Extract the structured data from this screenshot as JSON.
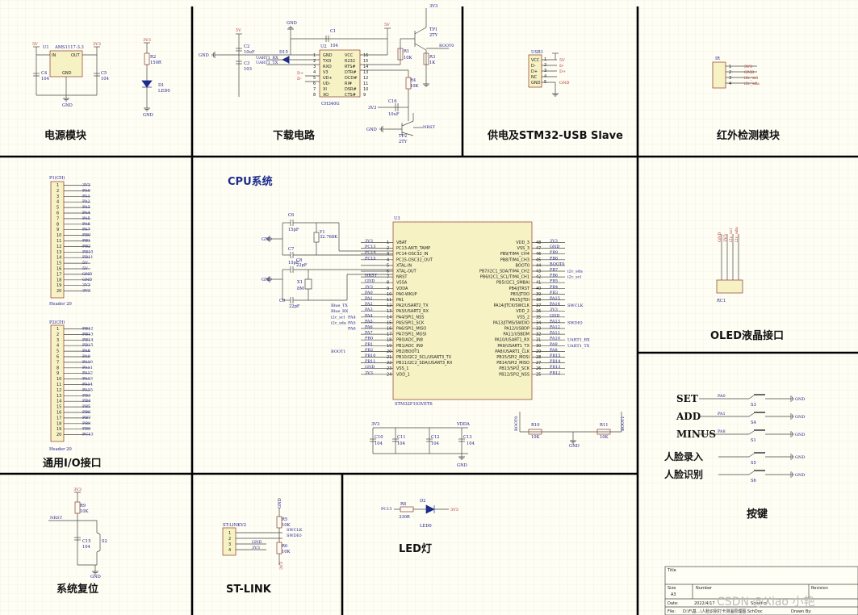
{
  "modules": {
    "power": "电源模块",
    "download": "下载电路",
    "usb": "供电及STM32-USB Slave",
    "ir": "红外检测模块",
    "cpu": "CPU系统",
    "oled": "OLED液晶接口",
    "io": "通用I/O接口",
    "keys": "按键",
    "reset": "系统复位",
    "stlink": "ST-LINK",
    "led": "LED灯"
  },
  "power": {
    "u1": "U1",
    "u1_part": "AMS1117-3.3",
    "in": "IN",
    "out": "OUT",
    "gnd_pin": "GND",
    "v5": "5V",
    "v33": "3V3",
    "c4": "C4",
    "c4v": "104",
    "c5": "C5",
    "c5v": "104",
    "gnd": "GND",
    "r2": "R2",
    "r2v": "150R",
    "d1": "D1",
    "d1v": "LED0"
  },
  "download": {
    "u2": "U2",
    "u2_part": "CH340G",
    "c1": "C1",
    "c1v": "104",
    "c2": "C2",
    "c2v": "10uF",
    "c3": "C3",
    "c3v": "103",
    "d15": "D15",
    "uart_rx": "UART1_RX",
    "uart_tx": "UART1_TX",
    "left_pins": [
      "GND",
      "TXD",
      "RXD",
      "V3",
      "UD+",
      "UD-",
      "XI",
      "XO"
    ],
    "left_nums": [
      "1",
      "2",
      "3",
      "4",
      "5",
      "6",
      "7",
      "8"
    ],
    "right_pins": [
      "VCC",
      "R232",
      "RTS#",
      "DTR#",
      "DCD#",
      "RI#",
      "DSR#",
      "CTS#"
    ],
    "right_nums": [
      "16",
      "15",
      "14",
      "13",
      "12",
      "11",
      "10",
      "9"
    ],
    "dp": "D+",
    "dm": "D-",
    "tp1": "TP1",
    "tp1v": "2TY",
    "tp2": "TP2",
    "tp2v": "2TY",
    "r1": "R1",
    "r1v": "10K",
    "r3": "R3",
    "r3v": "1K",
    "r4": "R4",
    "r4v": "10K",
    "c16": "C16",
    "c16v": "10uF",
    "boot0": "BOOT0",
    "nrst": "NRST",
    "v5": "5V",
    "v33": "3V3",
    "gnd": "GND"
  },
  "usb": {
    "ref": "USB1",
    "pins": [
      "VCC",
      "D-",
      "D+",
      "NC",
      "GND"
    ],
    "nums": [
      "1",
      "2",
      "3",
      "4",
      "5"
    ],
    "nets": [
      "5V",
      "D-",
      "D+",
      "",
      "GND"
    ]
  },
  "ir": {
    "ref": "IR",
    "nums": [
      "1",
      "2",
      "3",
      "4"
    ],
    "nets": [
      "3V3",
      "GND",
      "i2c_scl",
      "i2c_sda"
    ]
  },
  "cpu": {
    "u3": "U3",
    "part": "STM32F103VET6",
    "c6": "C6",
    "c6v": "15pF",
    "c7": "C7",
    "c7v": "15pF",
    "y1": "Y1",
    "y1v": "32.768K",
    "c8": "C8",
    "c8v": "22pF",
    "c9": "C9",
    "c9v": "22pF",
    "x1": "X1",
    "x1v": "8M",
    "left_pins": [
      "VBAT",
      "PC13-ANTI_TAMP",
      "PC14-OSC32_IN",
      "PC15-OSC32_OUT",
      "XTAL-IN",
      "XTAL-OUT",
      "NRST",
      "VSSA",
      "VDDA",
      "PA0-WKUP",
      "PA1",
      "PA2/USART2_TX",
      "PA3/USART2_RX",
      "PA4/SPI1_NSS",
      "PA5/SPI1_SCK",
      "PA6/SPI1_MISO",
      "PA7/SPI1_MOSI",
      "PB0/ADC_IN8",
      "PB1/ADC_IN9",
      "PB2/BOOT1",
      "PB10/I2C2_SCL/USART3_TX",
      "PB11/I2C2_SDA/USART3_RX",
      "VSS_1",
      "VDD_1"
    ],
    "left_nums": [
      "1",
      "2",
      "3",
      "4",
      "5",
      "6",
      "7",
      "8",
      "9",
      "10",
      "11",
      "12",
      "13",
      "14",
      "15",
      "16",
      "17",
      "18",
      "19",
      "20",
      "21",
      "22",
      "23",
      "24"
    ],
    "left_nets": [
      "3V3",
      "PC13",
      "PC14",
      "PC15",
      "",
      "",
      "NRST",
      "GND",
      "3V3",
      "PA0",
      "PA1",
      "PA2",
      "PA3",
      "PA4",
      "PA5",
      "PA6",
      "PA7",
      "PB0",
      "PB1",
      "PB2",
      "PB10",
      "PB11",
      "GND",
      "3V3"
    ],
    "left_ext": [
      "",
      "",
      "",
      "",
      "",
      "",
      "",
      "",
      "",
      "",
      "",
      "Blue_TX",
      "Blue_RX",
      "i2c_scl",
      "i2c_sda",
      "",
      "",
      "",
      "",
      "BOOT1",
      "",
      "",
      "",
      ""
    ],
    "left_ext_extra": [
      "",
      "",
      "",
      "",
      "",
      "",
      "",
      "",
      "",
      "",
      "",
      "",
      "",
      "PA4",
      "PA5",
      "PA6",
      "",
      "",
      "",
      "",
      "",
      "",
      "",
      ""
    ],
    "right_pins": [
      "VDD_3",
      "VSS_3",
      "PB9/TIM4_CH4",
      "PB8/TIM4_CH3",
      "BOOT0",
      "PB7/I2C1_SDA/TIM4_CH2",
      "PB6/I2C1_SCL/TIM4_CH1",
      "PB5/I2C1_SMBAI",
      "PB4/JTRST",
      "PB3/JTDO",
      "PA15/JTDI",
      "PA14/JTCK/SWCLK",
      "VDD_2",
      "VSS_2",
      "PA13/JTMS/SWDIO",
      "PA12/USBDP",
      "PA11/USBDM",
      "PA10/USART1_RX",
      "PA9/USART1_TX",
      "PA8/USART1_CLK",
      "PB15/SPI2_MOSI",
      "PB14/SPI2_MISO",
      "PB13/SPI2_SCK",
      "PB12/SPI2_NSS"
    ],
    "right_nums": [
      "48",
      "47",
      "46",
      "45",
      "44",
      "43",
      "42",
      "41",
      "40",
      "39",
      "38",
      "37",
      "36",
      "35",
      "34",
      "33",
      "32",
      "31",
      "30",
      "29",
      "28",
      "27",
      "26",
      "25"
    ],
    "right_nets": [
      "3V3",
      "GND",
      "PB9",
      "PB8",
      "BOOT0",
      "PB7",
      "PB6",
      "PB5",
      "PB4",
      "PB3",
      "PA15",
      "PA14",
      "3V3",
      "GND",
      "PA13",
      "PA12",
      "PA11",
      "PA10",
      "PA9",
      "PA8",
      "PB15",
      "PB14",
      "PB13",
      "PB12"
    ],
    "right_ext": [
      "",
      "",
      "",
      "",
      "",
      "i2c_sda",
      "i2c_scl",
      "",
      "",
      "",
      "",
      "SWCLK",
      "",
      "",
      "SWDIO",
      "",
      "",
      "UART1_RX",
      "UART1_TX",
      "",
      "",
      "",
      "",
      ""
    ],
    "c10": "C10",
    "c11": "C11",
    "c12": "C12",
    "c13": "C13",
    "cv": "104",
    "v33": "3V3",
    "vdda": "VDDA",
    "gnd": "GND",
    "boot0": "BOOT0",
    "boot1": "BOOT1",
    "r10": "R10",
    "r11": "R11",
    "rv": "10K"
  },
  "io": {
    "p1": "P1(CH)",
    "p2": "P2(CH)",
    "nums": [
      "1",
      "2",
      "3",
      "4",
      "5",
      "6",
      "7",
      "8",
      "9",
      "10",
      "11",
      "12",
      "13",
      "14",
      "15",
      "16",
      "17",
      "18",
      "19",
      "20"
    ],
    "p1_nets": [
      "3V3",
      "PA0",
      "PA1",
      "PA2",
      "PA3",
      "PA4",
      "PA5",
      "PA6",
      "PA7",
      "PB0",
      "PB1",
      "PB2",
      "PB10",
      "PB11",
      "5V",
      "5V",
      "GND",
      "GND",
      "3V3",
      "3V3"
    ],
    "p2_nets": [
      "PB12",
      "PB13",
      "PB14",
      "PB15",
      "PA8",
      "PA9",
      "PA10",
      "PA11",
      "PA12",
      "PA13",
      "PA14",
      "PA15",
      "PB3",
      "PB4",
      "PB5",
      "PB6",
      "PB7",
      "PB8",
      "PB9",
      "PC13"
    ],
    "hdr": "Header 20"
  },
  "oled": {
    "ref": "RC1",
    "nets": [
      "GND",
      "3V3",
      "i2c_scl",
      "i2c_sda"
    ]
  },
  "keys": {
    "names": [
      "SET",
      "ADD",
      "MINUS",
      "人脸录入",
      "人脸识别"
    ],
    "nets": [
      "PA0",
      "PA1",
      "PA8",
      "",
      ""
    ],
    "refs": [
      "S3",
      "S4",
      "S1",
      "S5",
      "S6"
    ],
    "gnd": "GND"
  },
  "reset": {
    "v33": "3V3",
    "r9": "R9",
    "r9v": "10K",
    "c15": "C15",
    "c15v": "104",
    "nrst": "NRST",
    "s2": "S2",
    "gnd": "GND"
  },
  "stlink": {
    "ref": "ST-LINKV2",
    "nums": [
      "1",
      "2",
      "3",
      "4"
    ],
    "nets": [
      "GND",
      "3V3"
    ],
    "r5": "R5",
    "r5v": "10K",
    "r6": "R6",
    "r6v": "10K",
    "swclk": "SWCLK",
    "swdio": "SWDIO",
    "gnd": "GND",
    "v33": "3V3"
  },
  "led": {
    "pc13": "PC13",
    "r8": "R8",
    "r8v": "330R",
    "d2": "D2",
    "d2v": "LED0",
    "v33": "3V3"
  },
  "titleblock": {
    "title": "Title",
    "size": "Size",
    "size_v": "A3",
    "number": "Number",
    "revision": "Revision",
    "date": "Date:",
    "date_v": "2022/4/17",
    "file": "File:",
    "file_v": "D:\\F\\基...\\人脸识别打卡测温原理图.SchDoc",
    "sheet": "Sheet of",
    "drawn": "Drawn By:"
  },
  "watermark": "CSDN @Xiao 小艳"
}
